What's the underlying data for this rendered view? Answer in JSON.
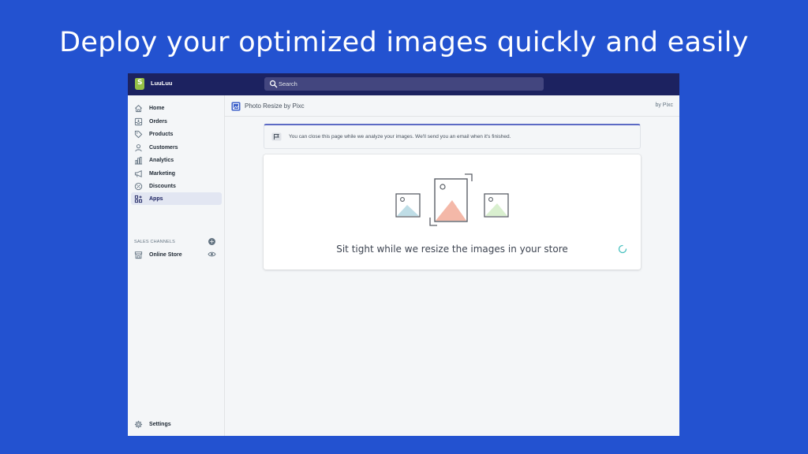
{
  "headline": "Deploy your optimized images quickly and easily",
  "topbar": {
    "store_name": "LuuLuu",
    "search_placeholder": "Search"
  },
  "sidebar": {
    "items": [
      {
        "label": "Home",
        "icon": "home-icon"
      },
      {
        "label": "Orders",
        "icon": "orders-icon"
      },
      {
        "label": "Products",
        "icon": "tag-icon"
      },
      {
        "label": "Customers",
        "icon": "person-icon"
      },
      {
        "label": "Analytics",
        "icon": "bar-chart-icon"
      },
      {
        "label": "Marketing",
        "icon": "megaphone-icon"
      },
      {
        "label": "Discounts",
        "icon": "discount-icon"
      },
      {
        "label": "Apps",
        "icon": "apps-icon",
        "active": true
      }
    ],
    "sales_channels_label": "SALES CHANNELS",
    "online_store_label": "Online Store",
    "settings_label": "Settings"
  },
  "app": {
    "title": "Photo Resize by Pixc",
    "by": "by Pixc",
    "banner_text": "You can close this page while we analyze your images. We'll send you an email when it's finished.",
    "card_text": "Sit tight while we resize the images in your store"
  },
  "colors": {
    "background": "#2352d0",
    "topbar": "#1c2260",
    "accent": "#5c6ac4"
  }
}
